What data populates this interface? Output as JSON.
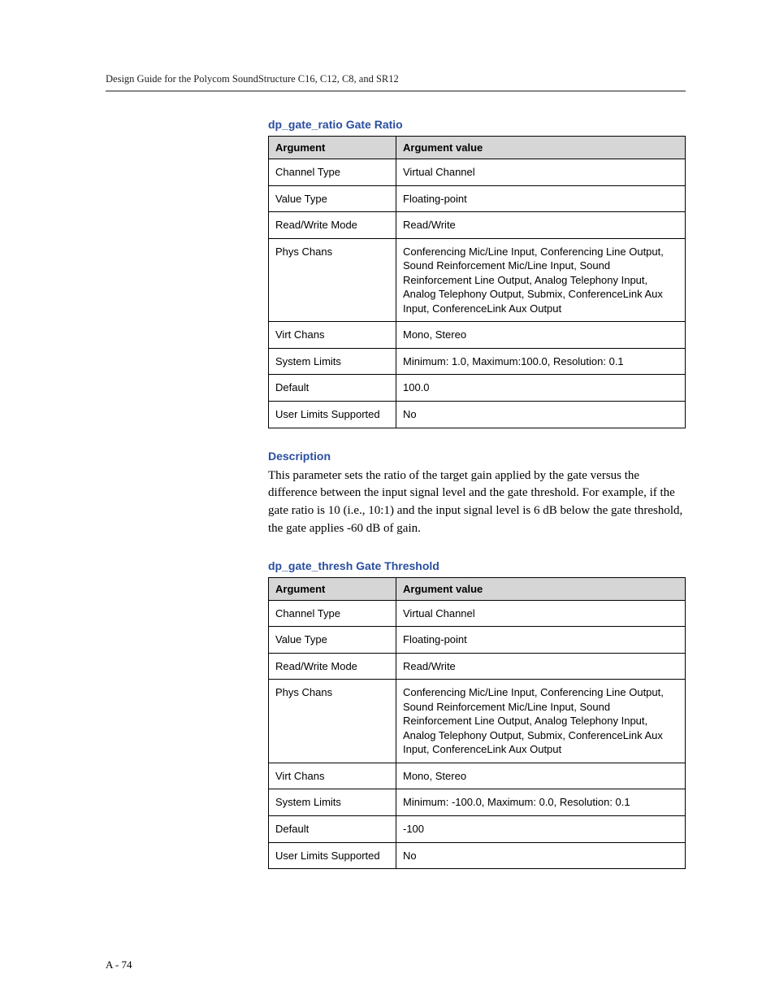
{
  "header": {
    "running": "Design Guide for the Polycom SoundStructure C16, C12, C8, and SR12"
  },
  "section1": {
    "title": "dp_gate_ratio Gate Ratio",
    "table": {
      "head": {
        "c1": "Argument",
        "c2": "Argument value"
      },
      "rows": [
        {
          "c1": "Channel Type",
          "c2": "Virtual Channel"
        },
        {
          "c1": "Value Type",
          "c2": "Floating-point"
        },
        {
          "c1": "Read/Write Mode",
          "c2": "Read/Write"
        },
        {
          "c1": "Phys Chans",
          "c2": "Conferencing Mic/Line Input, Conferencing Line Output, Sound Reinforcement Mic/Line Input, Sound Reinforcement Line Output, Analog Telephony Input, Analog Telephony Output, Submix, ConferenceLink Aux Input, ConferenceLink Aux Output"
        },
        {
          "c1": "Virt Chans",
          "c2": "Mono, Stereo"
        },
        {
          "c1": "System Limits",
          "c2": "Minimum: 1.0, Maximum:100.0, Resolution: 0.1"
        },
        {
          "c1": "Default",
          "c2": "100.0"
        },
        {
          "c1": "User Limits Supported",
          "c2": "No"
        }
      ]
    },
    "descHeading": "Description",
    "desc": "This parameter sets the ratio of the target gain applied by the gate versus the difference between the input signal level and the gate threshold. For example, if the gate ratio is 10 (i.e., 10:1) and the input signal level is 6 dB below the gate threshold, the gate applies -60 dB of gain."
  },
  "section2": {
    "title": "dp_gate_thresh Gate Threshold",
    "table": {
      "head": {
        "c1": "Argument",
        "c2": "Argument value"
      },
      "rows": [
        {
          "c1": "Channel Type",
          "c2": "Virtual Channel"
        },
        {
          "c1": "Value Type",
          "c2": "Floating-point"
        },
        {
          "c1": "Read/Write Mode",
          "c2": "Read/Write"
        },
        {
          "c1": "Phys Chans",
          "c2": "Conferencing Mic/Line Input, Conferencing Line Output, Sound Reinforcement Mic/Line Input, Sound Reinforcement Line Output, Analog Telephony Input, Analog Telephony Output, Submix, ConferenceLink Aux Input, ConferenceLink Aux Output"
        },
        {
          "c1": "Virt Chans",
          "c2": "Mono, Stereo"
        },
        {
          "c1": "System Limits",
          "c2": "Minimum: -100.0, Maximum: 0.0, Resolution: 0.1"
        },
        {
          "c1": "Default",
          "c2": "-100"
        },
        {
          "c1": "User Limits Supported",
          "c2": "No"
        }
      ]
    }
  },
  "footer": {
    "pageNumber": "A - 74"
  }
}
